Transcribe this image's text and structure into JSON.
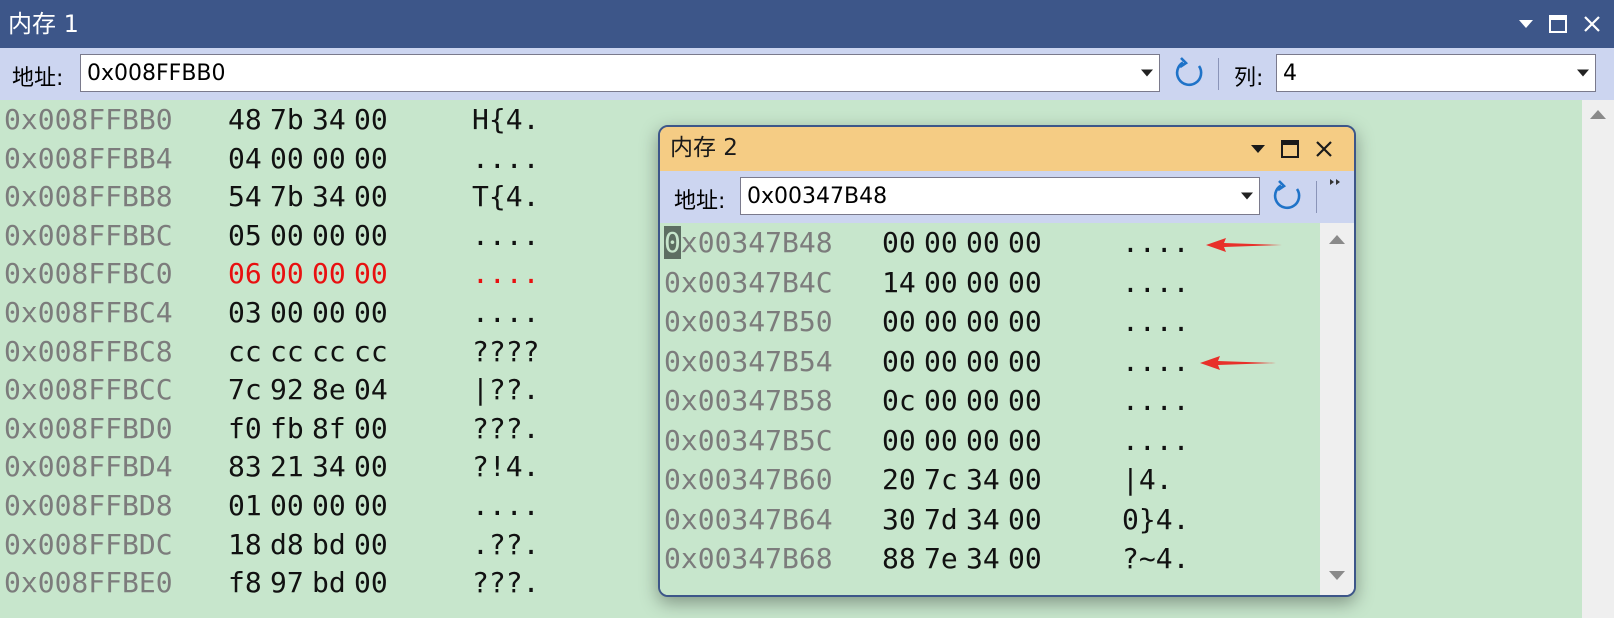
{
  "memory1": {
    "title": "内存 1",
    "address_label": "地址:",
    "address_value": "0x008FFBB0",
    "columns_label": "列:",
    "columns_value": "4",
    "rows": [
      {
        "addr": "0x008FFBB0",
        "h0": "48",
        "h1": "7b",
        "h2": "34",
        "h3": "00",
        "text": "H{4."
      },
      {
        "addr": "0x008FFBB4",
        "h0": "04",
        "h1": "00",
        "h2": "00",
        "h3": "00",
        "text": "...."
      },
      {
        "addr": "0x008FFBB8",
        "h0": "54",
        "h1": "7b",
        "h2": "34",
        "h3": "00",
        "text": "T{4."
      },
      {
        "addr": "0x008FFBBC",
        "h0": "05",
        "h1": "00",
        "h2": "00",
        "h3": "00",
        "text": "...."
      },
      {
        "addr": "0x008FFBC0",
        "h0": "06",
        "h1": "00",
        "h2": "00",
        "h3": "00",
        "text": "...."
      },
      {
        "addr": "0x008FFBC4",
        "h0": "03",
        "h1": "00",
        "h2": "00",
        "h3": "00",
        "text": "...."
      },
      {
        "addr": "0x008FFBC8",
        "h0": "cc",
        "h1": "cc",
        "h2": "cc",
        "h3": "cc",
        "text": "????"
      },
      {
        "addr": "0x008FFBCC",
        "h0": "7c",
        "h1": "92",
        "h2": "8e",
        "h3": "04",
        "text": "|??."
      },
      {
        "addr": "0x008FFBD0",
        "h0": "f0",
        "h1": "fb",
        "h2": "8f",
        "h3": "00",
        "text": "???."
      },
      {
        "addr": "0x008FFBD4",
        "h0": "83",
        "h1": "21",
        "h2": "34",
        "h3": "00",
        "text": "?!4."
      },
      {
        "addr": "0x008FFBD8",
        "h0": "01",
        "h1": "00",
        "h2": "00",
        "h3": "00",
        "text": "...."
      },
      {
        "addr": "0x008FFBDC",
        "h0": "18",
        "h1": "d8",
        "h2": "bd",
        "h3": "00",
        "text": ".??."
      },
      {
        "addr": "0x008FFBE0",
        "h0": "f8",
        "h1": "97",
        "h2": "bd",
        "h3": "00",
        "text": "???."
      }
    ]
  },
  "memory2": {
    "title": "内存 2",
    "address_label": "地址:",
    "address_value": "0x00347B48",
    "rows": [
      {
        "addr": "0x00347B48",
        "h0": "00",
        "h1": "00",
        "h2": "00",
        "h3": "00",
        "text": "...."
      },
      {
        "addr": "0x00347B4C",
        "h0": "14",
        "h1": "00",
        "h2": "00",
        "h3": "00",
        "text": "...."
      },
      {
        "addr": "0x00347B50",
        "h0": "00",
        "h1": "00",
        "h2": "00",
        "h3": "00",
        "text": "...."
      },
      {
        "addr": "0x00347B54",
        "h0": "00",
        "h1": "00",
        "h2": "00",
        "h3": "00",
        "text": "...."
      },
      {
        "addr": "0x00347B58",
        "h0": "0c",
        "h1": "00",
        "h2": "00",
        "h3": "00",
        "text": "...."
      },
      {
        "addr": "0x00347B5C",
        "h0": "00",
        "h1": "00",
        "h2": "00",
        "h3": "00",
        "text": "...."
      },
      {
        "addr": "0x00347B60",
        "h0": "20",
        "h1": "7c",
        "h2": "34",
        "h3": "00",
        "text": " |4."
      },
      {
        "addr": "0x00347B64",
        "h0": "30",
        "h1": "7d",
        "h2": "34",
        "h3": "00",
        "text": "0}4."
      },
      {
        "addr": "0x00347B68",
        "h0": "88",
        "h1": "7e",
        "h2": "34",
        "h3": "00",
        "text": "?~4."
      }
    ]
  },
  "colors": {
    "title1_bg": "#3d5689",
    "title2_bg": "#f5cc84",
    "toolbar_bg": "#ccd5f0",
    "memory_bg": "#c7e6cc",
    "changed_value": "#e81010",
    "annotation_arrow": "#e8302a"
  },
  "icons": [
    "dropdown-arrow-icon",
    "maximize-icon",
    "close-icon",
    "refresh-icon",
    "chevron-down-icon",
    "overflow-icon",
    "scroll-up-icon",
    "scroll-down-icon",
    "red-arrow-icon"
  ]
}
